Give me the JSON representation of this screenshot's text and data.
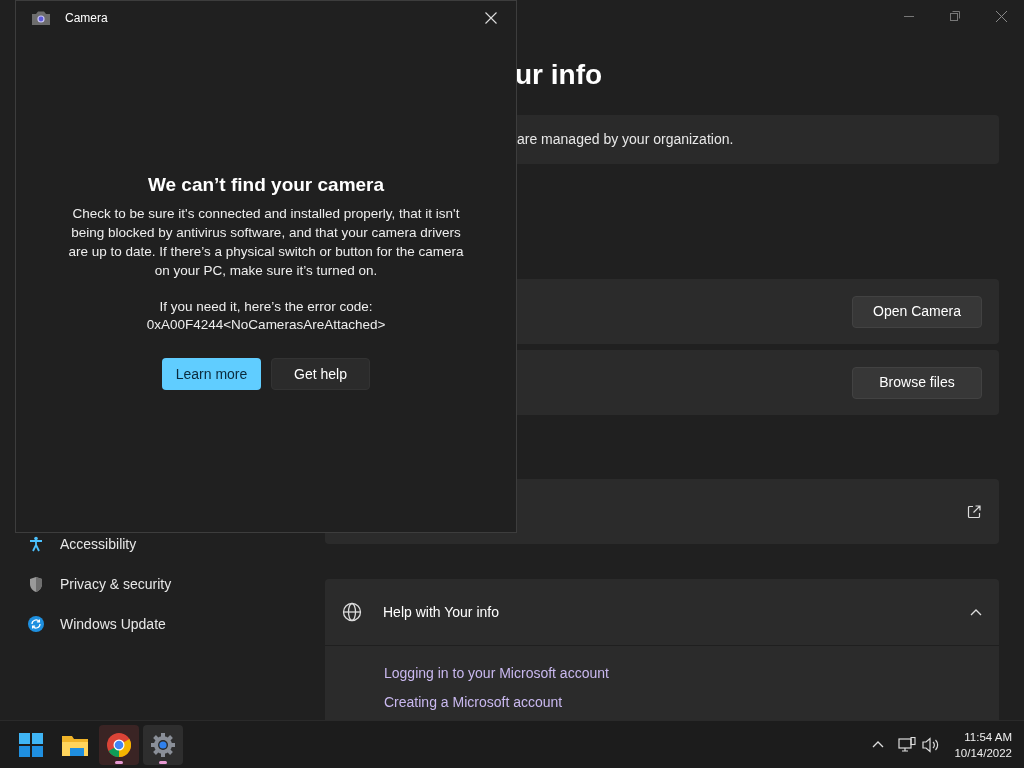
{
  "camera_dialog": {
    "title": "Camera",
    "heading": "We can’t find your camera",
    "message": "Check to be sure it's connected and installed properly, that it isn't being blocked by antivirus software, and that your camera drivers are up to date. If there’s a physical switch or button for the camera on your PC, make sure it’s turned on.",
    "error_intro": "If you need it, here’s the error code:",
    "error_code": "0xA00F4244<NoCamerasAreAttached>",
    "buttons": [
      {
        "label": "Learn more",
        "kind": "primary"
      },
      {
        "label": "Get help",
        "kind": "secondary"
      }
    ]
  },
  "sidebar": {
    "items": [
      {
        "label": "Accessibility",
        "kind": "accessibility"
      },
      {
        "label": "Privacy & security",
        "kind": "shield"
      },
      {
        "label": "Windows Update",
        "kind": "update"
      }
    ]
  },
  "settings": {
    "title": "ur info",
    "notice": "are managed by your organization.",
    "cards": [
      {
        "kind": "button",
        "button": "Open Camera"
      },
      {
        "kind": "button",
        "button": "Browse files"
      },
      {
        "kind": "external"
      }
    ],
    "help": {
      "title": "Help with Your info",
      "expanded": true,
      "links": [
        "Logging in to your Microsoft account",
        "Creating a Microsoft account"
      ]
    }
  },
  "taskbar": {
    "apps": [
      {
        "kind": "start",
        "running": false
      },
      {
        "kind": "folder",
        "running": false
      },
      {
        "kind": "browser",
        "running": true
      },
      {
        "kind": "settings",
        "running": true
      }
    ],
    "time": "11:54 AM",
    "date": "10/14/2022"
  }
}
